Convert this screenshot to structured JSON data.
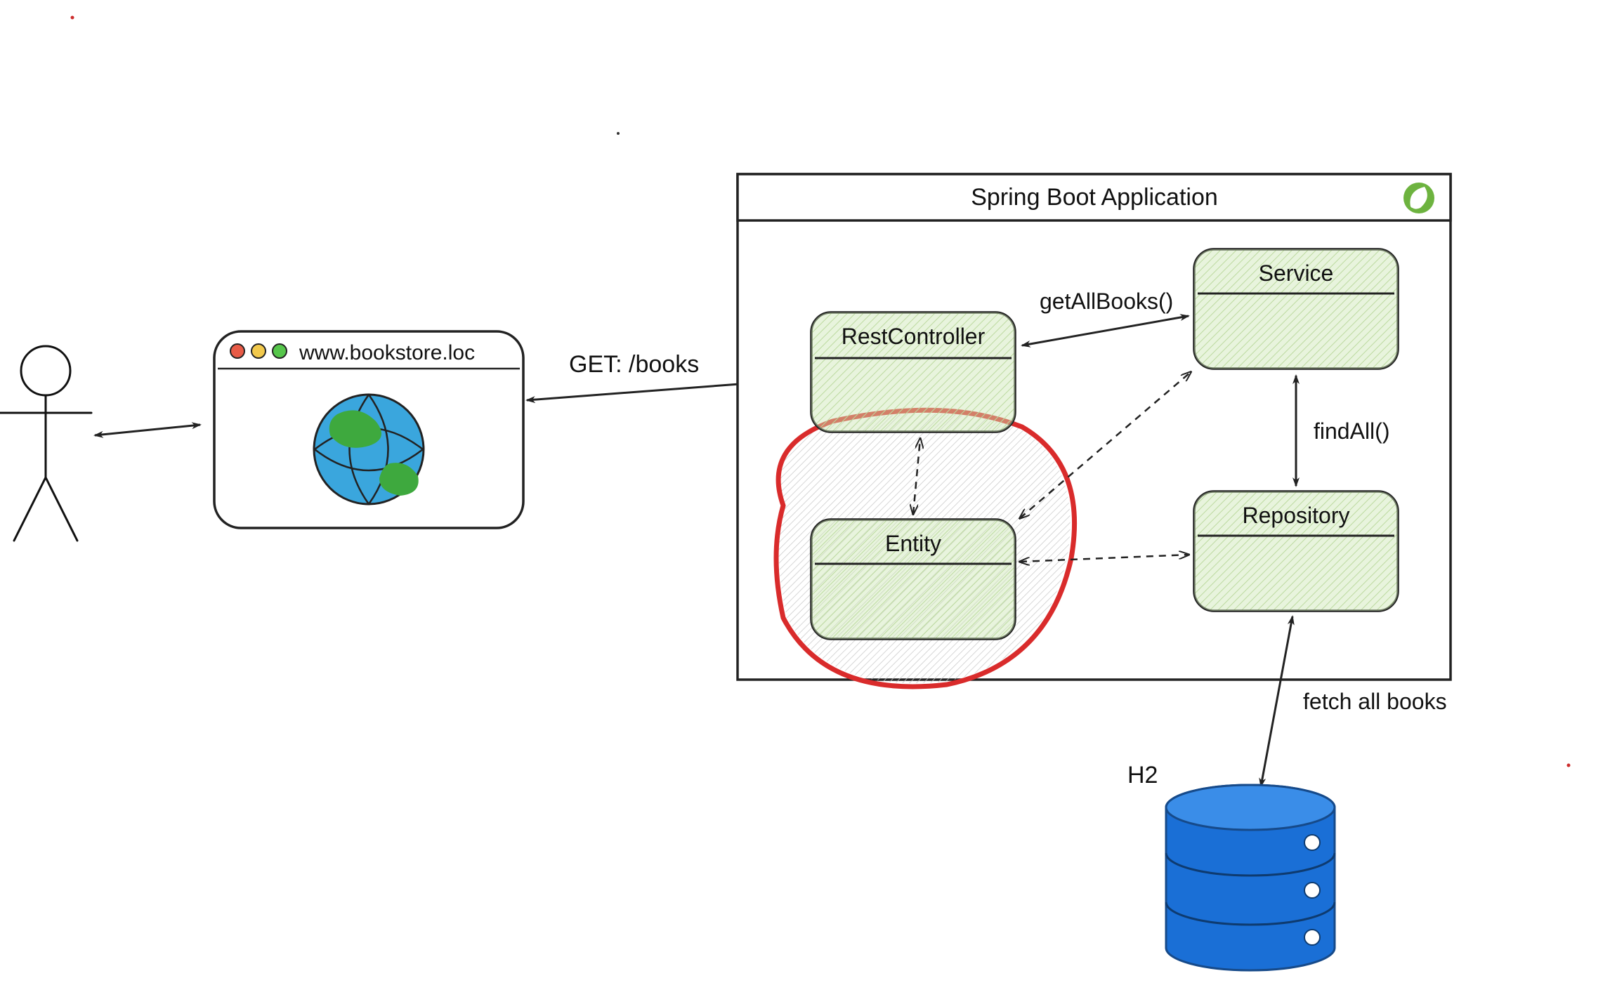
{
  "app_container": {
    "title": "Spring Boot Application"
  },
  "browser": {
    "url": "www.bookstore.loc"
  },
  "components": {
    "rest_controller": "RestController",
    "service": "Service",
    "repository": "Repository",
    "entity": "Entity"
  },
  "arrows": {
    "http_request": "GET: /books",
    "controller_to_service": "getAllBooks()",
    "service_to_repository": "findAll()",
    "repository_to_db": "fetch all books"
  },
  "database": {
    "label": "H2"
  }
}
